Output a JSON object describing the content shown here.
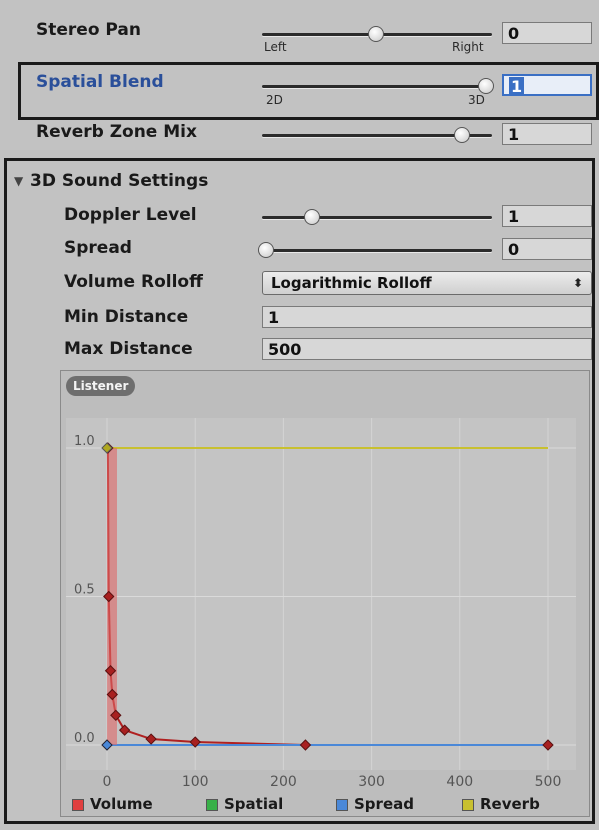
{
  "stereo_pan": {
    "label": "Stereo Pan",
    "value": "0",
    "left_tick": "Left",
    "right_tick": "Right",
    "level": 0.5
  },
  "spatial_blend": {
    "label": "Spatial Blend",
    "value": "1",
    "left_tick": "2D",
    "right_tick": "3D",
    "level": 1.0
  },
  "reverb_zone_mix": {
    "label": "Reverb Zone Mix",
    "value": "1",
    "level": 0.9
  },
  "sound_3d": {
    "header": "3D Sound Settings",
    "doppler": {
      "label": "Doppler Level",
      "value": "1",
      "level": 0.22
    },
    "spread": {
      "label": "Spread",
      "value": "0",
      "level": 0.0
    },
    "volume_rolloff": {
      "label": "Volume Rolloff",
      "selected": "Logarithmic Rolloff",
      "arrow": "⬍"
    },
    "min_distance": {
      "label": "Min Distance",
      "value": "1"
    },
    "max_distance": {
      "label": "Max Distance",
      "value": "500"
    }
  },
  "graph": {
    "listener_badge": "Listener",
    "y_ticks": [
      "1.0",
      "0.5",
      "0.0"
    ],
    "x_ticks": [
      "0",
      "100",
      "200",
      "300",
      "400",
      "500"
    ],
    "legend": [
      {
        "label": "Volume",
        "color": "#e04040"
      },
      {
        "label": "Spatial",
        "color": "#38b048"
      },
      {
        "label": "Spread",
        "color": "#4a88d8"
      },
      {
        "label": "Reverb",
        "color": "#c8c030"
      }
    ]
  },
  "chart_data": {
    "type": "line",
    "xlim": [
      0,
      500
    ],
    "ylim": [
      0,
      1
    ],
    "series": [
      {
        "name": "Volume",
        "color": "#b02020",
        "x": [
          1,
          2,
          4,
          6,
          10,
          20,
          50,
          100,
          225,
          500
        ],
        "y": [
          1.0,
          0.5,
          0.25,
          0.17,
          0.1,
          0.05,
          0.02,
          0.01,
          0.0,
          0.0
        ]
      },
      {
        "name": "Spatial",
        "color": "#38b048",
        "x": [
          0,
          500
        ],
        "y": [
          1.0,
          1.0
        ]
      },
      {
        "name": "Spread",
        "color": "#4a88d8",
        "x": [
          0,
          500
        ],
        "y": [
          0.0,
          0.0
        ]
      },
      {
        "name": "Reverb",
        "color": "#c8c030",
        "x": [
          0,
          500
        ],
        "y": [
          1.0,
          1.0
        ]
      }
    ]
  }
}
